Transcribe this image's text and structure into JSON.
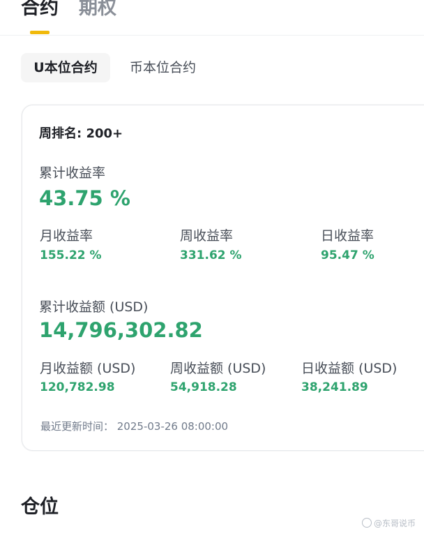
{
  "top_tabs": [
    {
      "label": "合约",
      "active": true
    },
    {
      "label": "期权",
      "active": false
    }
  ],
  "segment": {
    "options": [
      "U本位合约",
      "币本位合约"
    ],
    "selected": "U本位合约"
  },
  "card": {
    "rank": "周排名: 200+",
    "cumulative_rate_label": "累计收益率",
    "cumulative_rate_value": "43.75 %",
    "rates": [
      {
        "label": "月收益率",
        "value": "155.22 %"
      },
      {
        "label": "周收益率",
        "value": "331.62 %"
      },
      {
        "label": "日收益率",
        "value": "95.47 %"
      }
    ],
    "cumulative_amount_label": "累计收益额 (USD)",
    "cumulative_amount_value": "14,796,302.82",
    "amounts": [
      {
        "label": "月收益额 (USD)",
        "value": "120,782.98"
      },
      {
        "label": "周收益额 (USD)",
        "value": "54,918.28"
      },
      {
        "label": "日收益额 (USD)",
        "value": "38,241.89"
      }
    ],
    "update_time": "最近更新时间：  2025-03-26 08:00:00"
  },
  "section_title": "仓位",
  "watermark": "@东哥说币",
  "colors": {
    "accent": "#f0b90b",
    "positive": "#2ea36e",
    "text": "#1e2026",
    "muted": "#474d57"
  }
}
